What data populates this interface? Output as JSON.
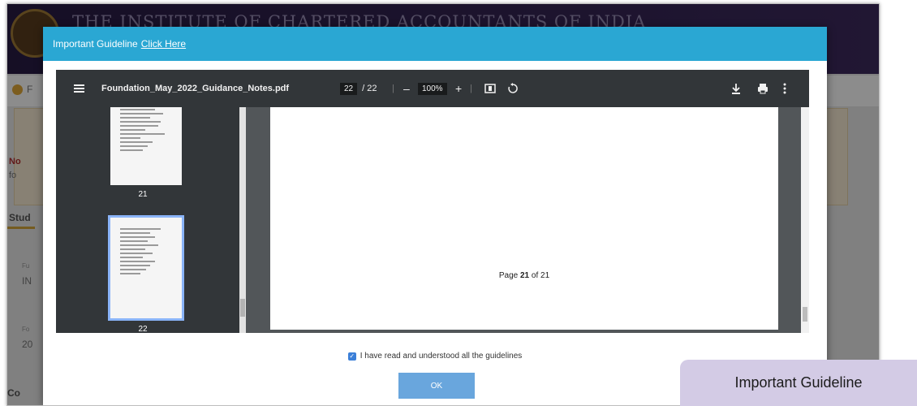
{
  "background": {
    "institute_title": "THE INSTITUTE OF CHARTERED ACCOUNTANTS OF INDIA",
    "subbar_text": "F",
    "notice_a": "No",
    "notice_b": "fo",
    "tab_label": "Stud",
    "field_a_label": "Fu",
    "field_a_value": "IN",
    "field_b_label": "Fo",
    "field_b_value": "20",
    "bottom_text": "Co"
  },
  "modal": {
    "header_text": "Important Guideline",
    "header_link": "Click Here",
    "agree_label": "I have read and understood all the guidelines",
    "agree_checked": true,
    "ok_label": "OK"
  },
  "pdf_viewer": {
    "filename": "Foundation_May_2022_Guidance_Notes.pdf",
    "current_page": "22",
    "total_pages": "/ 22",
    "zoom": "100%",
    "zoom_out": "–",
    "zoom_in": "+",
    "thumbnails": [
      {
        "page": "21",
        "selected": false
      },
      {
        "page": "22",
        "selected": true
      }
    ],
    "page_footer": {
      "prefix": "Page",
      "number": "21",
      "middle": "of",
      "total": "21"
    },
    "icons": {
      "menu": "menu-icon",
      "fit": "fit-page-icon",
      "rotate": "rotate-icon",
      "download": "download-icon",
      "print": "print-icon",
      "more": "more-vert-icon"
    }
  },
  "badge": {
    "label": "Important Guideline"
  },
  "colors": {
    "modal_header": "#2aa7d3",
    "ok_button": "#69a6dd",
    "pdf_toolbar": "#323639",
    "badge": "#d3cbe5"
  }
}
